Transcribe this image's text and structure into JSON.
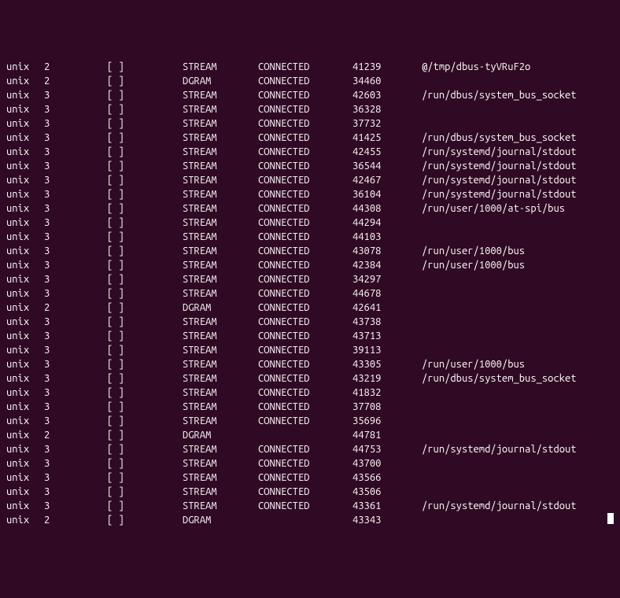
{
  "colors": {
    "background": "#300a24",
    "foreground": "#ffffff"
  },
  "rows": [
    {
      "proto": "unix",
      "refcnt": "2",
      "flags": "[ ]",
      "type": "STREAM",
      "state": "CONNECTED",
      "inode": "41239",
      "path": "@/tmp/dbus-tyVRuF2o"
    },
    {
      "proto": "unix",
      "refcnt": "2",
      "flags": "[ ]",
      "type": "DGRAM",
      "state": "CONNECTED",
      "inode": "34460",
      "path": ""
    },
    {
      "proto": "unix",
      "refcnt": "3",
      "flags": "[ ]",
      "type": "STREAM",
      "state": "CONNECTED",
      "inode": "42603",
      "path": "/run/dbus/system_bus_socket"
    },
    {
      "proto": "unix",
      "refcnt": "3",
      "flags": "[ ]",
      "type": "STREAM",
      "state": "CONNECTED",
      "inode": "36328",
      "path": ""
    },
    {
      "proto": "unix",
      "refcnt": "3",
      "flags": "[ ]",
      "type": "STREAM",
      "state": "CONNECTED",
      "inode": "37732",
      "path": ""
    },
    {
      "proto": "unix",
      "refcnt": "3",
      "flags": "[ ]",
      "type": "STREAM",
      "state": "CONNECTED",
      "inode": "41425",
      "path": "/run/dbus/system_bus_socket"
    },
    {
      "proto": "unix",
      "refcnt": "3",
      "flags": "[ ]",
      "type": "STREAM",
      "state": "CONNECTED",
      "inode": "42455",
      "path": "/run/systemd/journal/stdout"
    },
    {
      "proto": "unix",
      "refcnt": "3",
      "flags": "[ ]",
      "type": "STREAM",
      "state": "CONNECTED",
      "inode": "36544",
      "path": "/run/systemd/journal/stdout"
    },
    {
      "proto": "unix",
      "refcnt": "3",
      "flags": "[ ]",
      "type": "STREAM",
      "state": "CONNECTED",
      "inode": "42467",
      "path": "/run/systemd/journal/stdout"
    },
    {
      "proto": "unix",
      "refcnt": "3",
      "flags": "[ ]",
      "type": "STREAM",
      "state": "CONNECTED",
      "inode": "36104",
      "path": "/run/systemd/journal/stdout"
    },
    {
      "proto": "unix",
      "refcnt": "3",
      "flags": "[ ]",
      "type": "STREAM",
      "state": "CONNECTED",
      "inode": "44308",
      "path": "/run/user/1000/at-spi/bus"
    },
    {
      "proto": "unix",
      "refcnt": "3",
      "flags": "[ ]",
      "type": "STREAM",
      "state": "CONNECTED",
      "inode": "44294",
      "path": ""
    },
    {
      "proto": "unix",
      "refcnt": "3",
      "flags": "[ ]",
      "type": "STREAM",
      "state": "CONNECTED",
      "inode": "44103",
      "path": ""
    },
    {
      "proto": "unix",
      "refcnt": "3",
      "flags": "[ ]",
      "type": "STREAM",
      "state": "CONNECTED",
      "inode": "43078",
      "path": "/run/user/1000/bus"
    },
    {
      "proto": "unix",
      "refcnt": "3",
      "flags": "[ ]",
      "type": "STREAM",
      "state": "CONNECTED",
      "inode": "42384",
      "path": "/run/user/1000/bus"
    },
    {
      "proto": "unix",
      "refcnt": "3",
      "flags": "[ ]",
      "type": "STREAM",
      "state": "CONNECTED",
      "inode": "34297",
      "path": ""
    },
    {
      "proto": "unix",
      "refcnt": "3",
      "flags": "[ ]",
      "type": "STREAM",
      "state": "CONNECTED",
      "inode": "44678",
      "path": ""
    },
    {
      "proto": "unix",
      "refcnt": "2",
      "flags": "[ ]",
      "type": "DGRAM",
      "state": "CONNECTED",
      "inode": "42641",
      "path": ""
    },
    {
      "proto": "unix",
      "refcnt": "3",
      "flags": "[ ]",
      "type": "STREAM",
      "state": "CONNECTED",
      "inode": "43738",
      "path": ""
    },
    {
      "proto": "unix",
      "refcnt": "3",
      "flags": "[ ]",
      "type": "STREAM",
      "state": "CONNECTED",
      "inode": "43713",
      "path": ""
    },
    {
      "proto": "unix",
      "refcnt": "3",
      "flags": "[ ]",
      "type": "STREAM",
      "state": "CONNECTED",
      "inode": "39113",
      "path": ""
    },
    {
      "proto": "unix",
      "refcnt": "3",
      "flags": "[ ]",
      "type": "STREAM",
      "state": "CONNECTED",
      "inode": "43305",
      "path": "/run/user/1000/bus"
    },
    {
      "proto": "unix",
      "refcnt": "3",
      "flags": "[ ]",
      "type": "STREAM",
      "state": "CONNECTED",
      "inode": "43219",
      "path": "/run/dbus/system_bus_socket"
    },
    {
      "proto": "unix",
      "refcnt": "3",
      "flags": "[ ]",
      "type": "STREAM",
      "state": "CONNECTED",
      "inode": "41832",
      "path": ""
    },
    {
      "proto": "unix",
      "refcnt": "3",
      "flags": "[ ]",
      "type": "STREAM",
      "state": "CONNECTED",
      "inode": "37708",
      "path": ""
    },
    {
      "proto": "unix",
      "refcnt": "3",
      "flags": "[ ]",
      "type": "STREAM",
      "state": "CONNECTED",
      "inode": "35696",
      "path": ""
    },
    {
      "proto": "unix",
      "refcnt": "2",
      "flags": "[ ]",
      "type": "DGRAM",
      "state": "",
      "inode": "44781",
      "path": ""
    },
    {
      "proto": "unix",
      "refcnt": "3",
      "flags": "[ ]",
      "type": "STREAM",
      "state": "CONNECTED",
      "inode": "44753",
      "path": "/run/systemd/journal/stdout"
    },
    {
      "proto": "unix",
      "refcnt": "3",
      "flags": "[ ]",
      "type": "STREAM",
      "state": "CONNECTED",
      "inode": "43700",
      "path": ""
    },
    {
      "proto": "unix",
      "refcnt": "3",
      "flags": "[ ]",
      "type": "STREAM",
      "state": "CONNECTED",
      "inode": "43566",
      "path": ""
    },
    {
      "proto": "unix",
      "refcnt": "3",
      "flags": "[ ]",
      "type": "STREAM",
      "state": "CONNECTED",
      "inode": "43506",
      "path": ""
    },
    {
      "proto": "unix",
      "refcnt": "3",
      "flags": "[ ]",
      "type": "STREAM",
      "state": "CONNECTED",
      "inode": "43361",
      "path": "/run/systemd/journal/stdout"
    },
    {
      "proto": "unix",
      "refcnt": "2",
      "flags": "[ ]",
      "type": "DGRAM",
      "state": "",
      "inode": "43343",
      "path": ""
    }
  ]
}
